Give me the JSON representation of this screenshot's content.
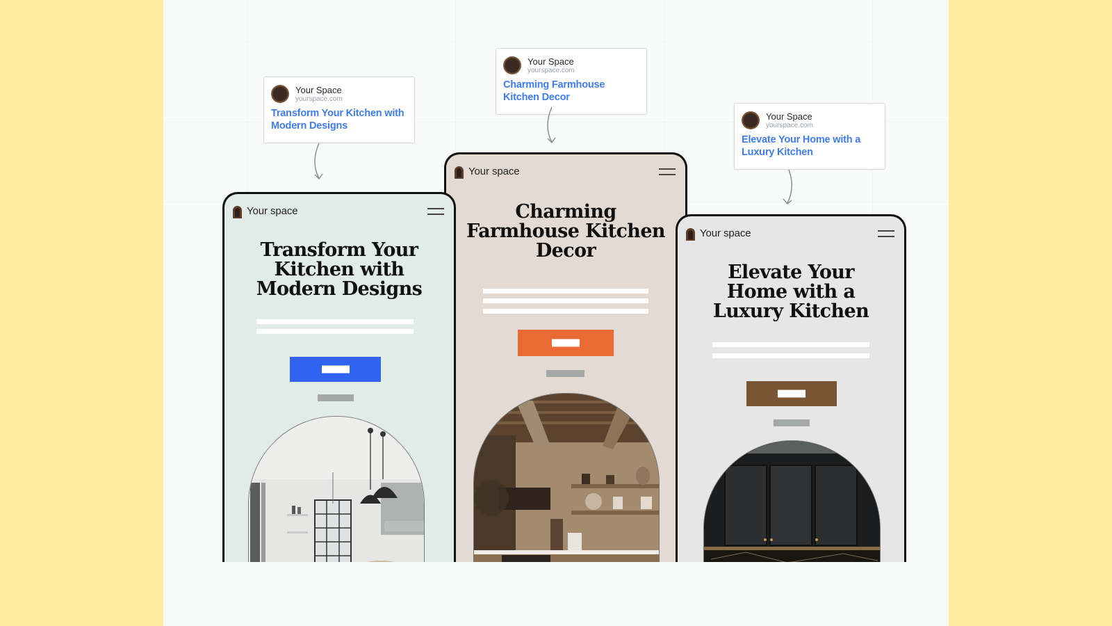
{
  "serp_cards": [
    {
      "site_name": "Your Space",
      "site_url": "yourspace.com",
      "title": "Transform Your Kitchen with Modern Designs"
    },
    {
      "site_name": "Your Space",
      "site_url": "yourspace.com",
      "title": "Charming Farmhouse Kitchen Decor"
    },
    {
      "site_name": "Your Space",
      "site_url": "yourspace.com",
      "title": "Elevate Your Home with a Luxury Kitchen"
    }
  ],
  "phones": [
    {
      "brand": "Your space",
      "headline": "Transform Your Kitchen with Modern Designs",
      "theme": "modern",
      "background": "#e1ebe7",
      "cta_color": "#2f63f0",
      "image": "modern-white-kitchen-with-pendant-lamps"
    },
    {
      "brand": "Your space",
      "headline": "Charming Farmhouse Kitchen Decor",
      "theme": "farmhouse",
      "background": "#e3dbd3",
      "cta_color": "#e96a33",
      "image": "rustic-farmhouse-kitchen-with-wood-beams"
    },
    {
      "brand": "Your space",
      "headline": "Elevate Your Home with a Luxury Kitchen",
      "theme": "luxury",
      "background": "#e6e6e6",
      "cta_color": "#7a5534",
      "image": "luxury-black-kitchen-cabinets"
    }
  ],
  "colors": {
    "page_background": "#fdeda0",
    "canvas": "#f9fafa",
    "link_blue": "#3f7cf0"
  }
}
